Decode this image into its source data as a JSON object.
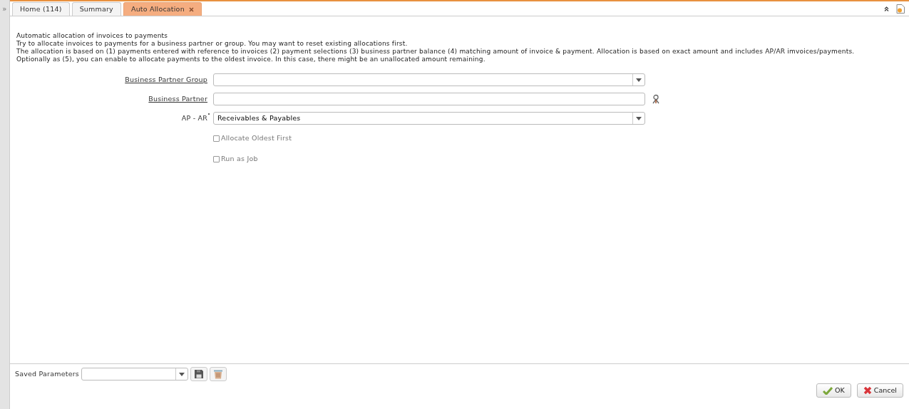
{
  "sidebar": {
    "toggle": "»"
  },
  "tabs": [
    {
      "label": "Home (114)",
      "selected": false,
      "closable": false
    },
    {
      "label": "Summary",
      "selected": false,
      "closable": false
    },
    {
      "label": "Auto Allocation",
      "selected": true,
      "closable": true
    }
  ],
  "description": [
    "Automatic allocation of invoices to payments",
    "Try to allocate invoices to payments for a business partner or group. You may want to reset existing allocations first.",
    "The allocation is based on (1) payments entered with reference to invoices (2) payment selections (3) business partner balance (4) matching amount of invoice & payment. Allocation is based on exact amount and includes AP/AR imvoices/payments.",
    "Optionally as (5), you can enable to allocate payments to the oldest invoice. In this case, there might be an unallocated amount remaining."
  ],
  "fields": [
    {
      "kind": "select",
      "label": "Business Partner Group",
      "link": true,
      "required": false
    },
    {
      "kind": "search",
      "label": "Business Partner",
      "link": true,
      "required": false
    },
    {
      "kind": "select",
      "label": "AP - AR",
      "link": false,
      "required": true,
      "value": "Receivables & Payables"
    }
  ],
  "checkboxes": [
    {
      "label": "Allocate Oldest First",
      "checked": false
    },
    {
      "label": "Run as Job",
      "checked": false
    }
  ],
  "saved_parameters": {
    "label": "Saved Parameters"
  },
  "buttons": [
    {
      "kind": "ok",
      "label": "OK"
    },
    {
      "kind": "cancel",
      "label": "Cancel"
    }
  ]
}
